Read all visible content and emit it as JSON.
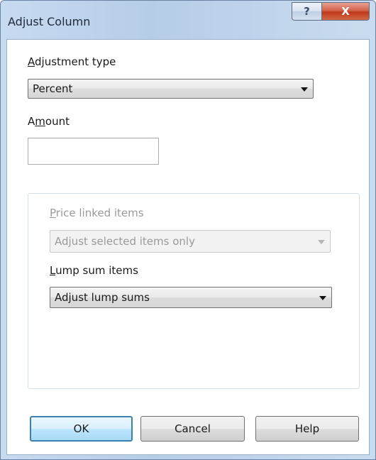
{
  "window": {
    "title": "Adjust Column",
    "help_glyph": "?",
    "close_glyph": "X"
  },
  "adjustment": {
    "label_accel": "A",
    "label_rest": "djustment type",
    "selected": "Percent"
  },
  "amount": {
    "label_pre": "A",
    "label_accel": "m",
    "label_post": "ount",
    "value": ""
  },
  "price_linked": {
    "label_accel": "P",
    "label_rest": "rice linked items",
    "selected": "Adjust selected items only",
    "enabled": false
  },
  "lump_sum": {
    "label_accel": "L",
    "label_rest": "ump sum items",
    "selected": "Adjust lump sums"
  },
  "buttons": {
    "ok": "OK",
    "cancel": "Cancel",
    "help": "Help"
  },
  "icons": {
    "help": "help-icon",
    "close": "close-icon",
    "dropdown": "chevron-down-icon"
  },
  "colors": {
    "default_button_border": "#3c7fb1",
    "close_button": "#c0381c",
    "disabled_text": "#9a9a9a"
  }
}
